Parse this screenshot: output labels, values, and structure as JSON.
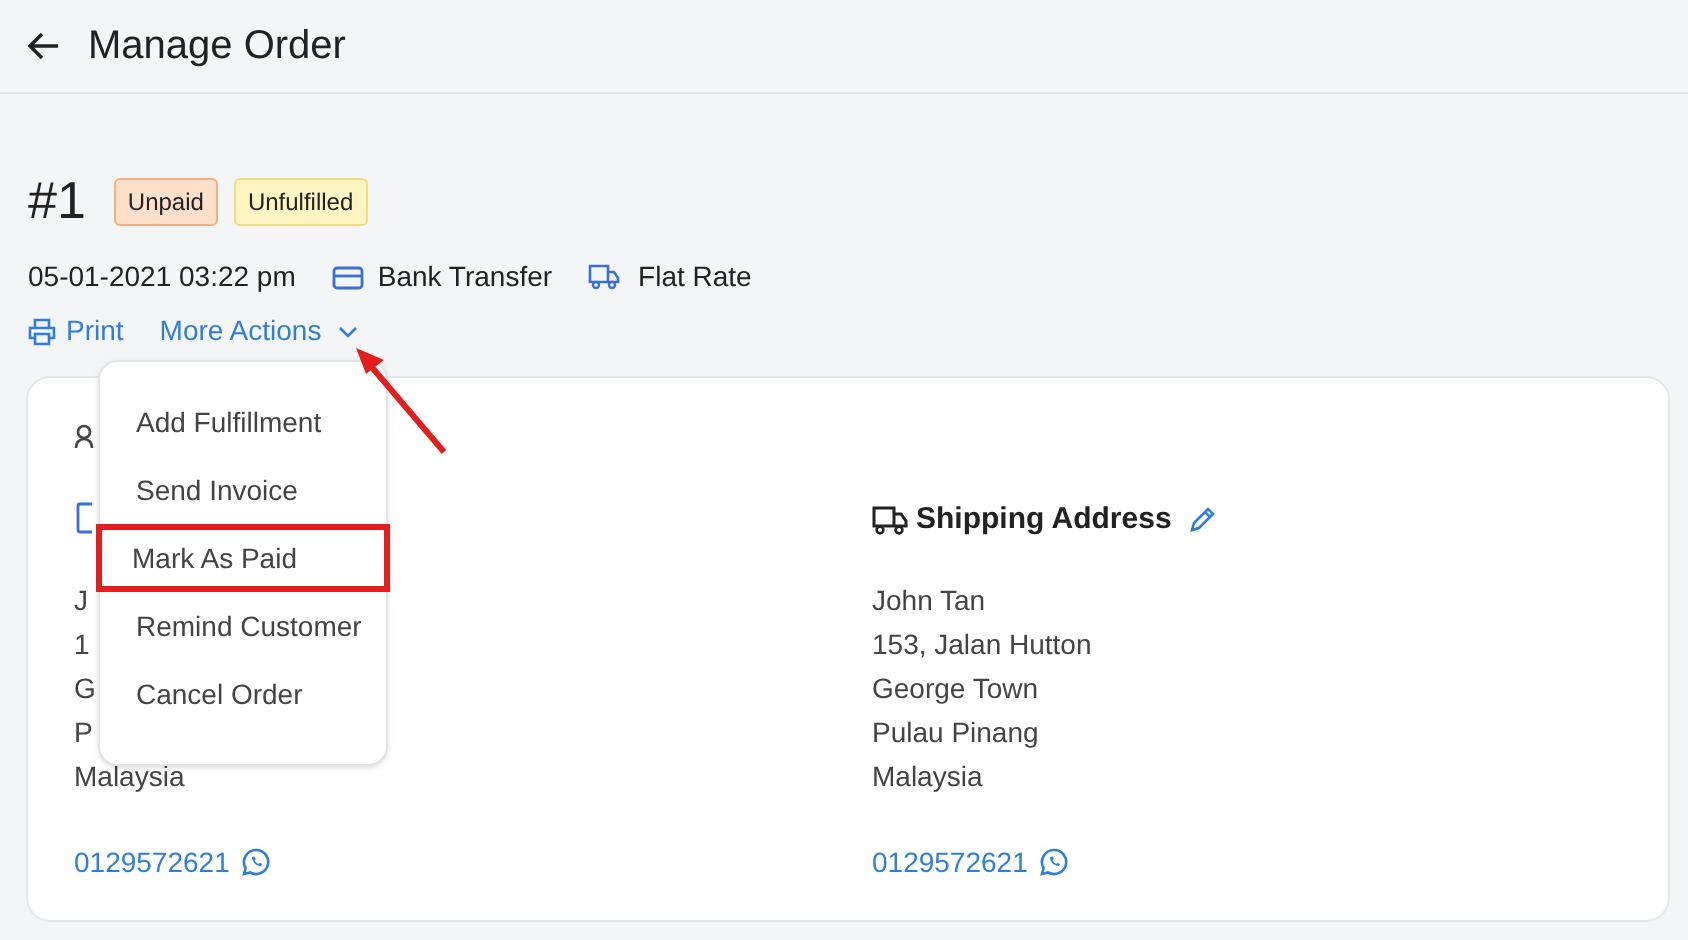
{
  "header": {
    "title": "Manage Order"
  },
  "order": {
    "number": "#1",
    "badges": [
      {
        "label": "Unpaid",
        "kind": "payment"
      },
      {
        "label": "Unfulfilled",
        "kind": "fulfillment"
      }
    ],
    "date": "05-01-2021 03:22 pm",
    "payment_method": "Bank Transfer",
    "shipping_method": "Flat Rate"
  },
  "actions": [
    {
      "label": "Print",
      "kind": "print"
    },
    {
      "label": "More Actions",
      "kind": "dropdown",
      "expanded": true,
      "pointed": true
    }
  ],
  "menu": [
    {
      "label": "Add Fulfillment",
      "highlighted": false
    },
    {
      "label": "Send Invoice",
      "highlighted": false
    },
    {
      "label": "Mark As Paid",
      "highlighted": true
    },
    {
      "label": "Remind Customer",
      "highlighted": false
    },
    {
      "label": "Cancel Order",
      "highlighted": false
    }
  ],
  "billing": {
    "lines": [
      "J",
      "1",
      "G",
      "P",
      "Malaysia"
    ],
    "phone": "0129572621"
  },
  "shipping": {
    "title": "Shipping Address",
    "lines": [
      "John Tan",
      "153, Jalan Hutton",
      "George Town",
      "Pulau Pinang",
      "Malaysia"
    ],
    "phone": "0129572621"
  }
}
